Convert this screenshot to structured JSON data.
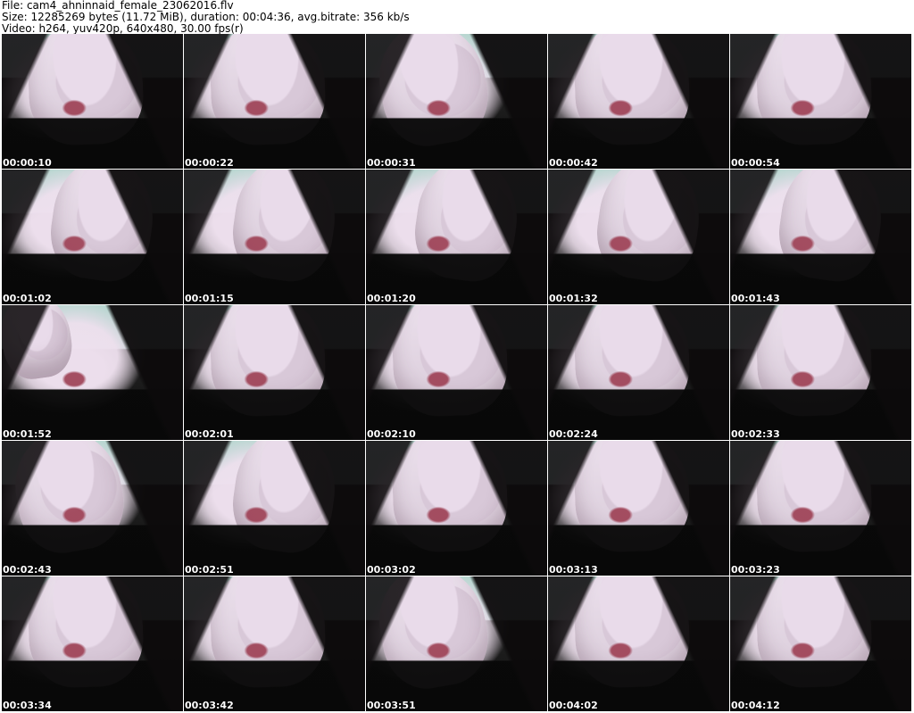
{
  "header": {
    "file": "File: cam4_ahninnaid_female_23062016.flv",
    "size": "Size: 12285269 bytes (11.72 MiB), duration: 00:04:36, avg.bitrate: 356 kb/s",
    "video": "Video: h264, yuv420p, 640x480, 30.00 fps(r)"
  },
  "thumbnails": [
    {
      "time": "00:00:10"
    },
    {
      "time": "00:00:22"
    },
    {
      "time": "00:00:31"
    },
    {
      "time": "00:00:42"
    },
    {
      "time": "00:00:54"
    },
    {
      "time": "00:01:02"
    },
    {
      "time": "00:01:15"
    },
    {
      "time": "00:01:20"
    },
    {
      "time": "00:01:32"
    },
    {
      "time": "00:01:43"
    },
    {
      "time": "00:01:52"
    },
    {
      "time": "00:02:01"
    },
    {
      "time": "00:02:10"
    },
    {
      "time": "00:02:24"
    },
    {
      "time": "00:02:33"
    },
    {
      "time": "00:02:43"
    },
    {
      "time": "00:02:51"
    },
    {
      "time": "00:03:02"
    },
    {
      "time": "00:03:13"
    },
    {
      "time": "00:03:23"
    },
    {
      "time": "00:03:34"
    },
    {
      "time": "00:03:42"
    },
    {
      "time": "00:03:51"
    },
    {
      "time": "00:04:02"
    },
    {
      "time": "00:04:12"
    }
  ]
}
